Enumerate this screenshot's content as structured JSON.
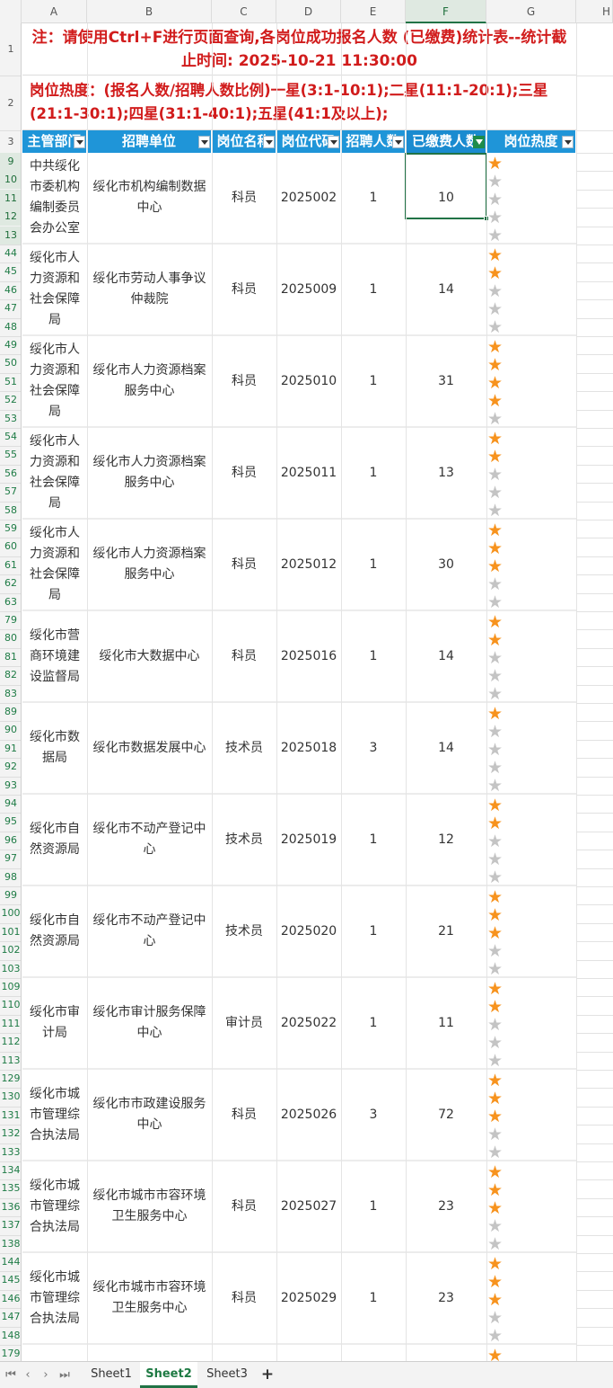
{
  "columns": [
    "A",
    "B",
    "C",
    "D",
    "E",
    "F",
    "G",
    "H"
  ],
  "title_note": "注：请使用Ctrl+F进行页面查询,各岗位成功报名人数 (已缴费)统计表--统计截止时间: 2025-10-21 11:30:00",
  "heat_note": "岗位热度：(报名人数/招聘人数比例)一星(3:1-10:1);二星(11:1-20:1);三星(21:1-30:1);四星(31:1-40:1);五星(41:1及以上);",
  "headers": [
    "主管部门",
    "招聘单位",
    "岗位名称",
    "岗位代码",
    "招聘人数",
    "已缴费人数",
    "岗位热度"
  ],
  "header_rows": [
    "1",
    "2",
    "3"
  ],
  "rows": [
    {
      "rownums": [
        "9",
        "10",
        "11",
        "12",
        "13"
      ],
      "dept": "中共绥化市委机构编制委员会办公室",
      "unit": "绥化市机构编制数据中心",
      "post": "科员",
      "code": "2025002",
      "quota": "1",
      "paid": "10",
      "stars": 1
    },
    {
      "rownums": [
        "44",
        "45",
        "46",
        "47",
        "48"
      ],
      "dept": "绥化市人力资源和社会保障局",
      "unit": "绥化市劳动人事争议仲裁院",
      "post": "科员",
      "code": "2025009",
      "quota": "1",
      "paid": "14",
      "stars": 2
    },
    {
      "rownums": [
        "49",
        "50",
        "51",
        "52",
        "53"
      ],
      "dept": "绥化市人力资源和社会保障局",
      "unit": "绥化市人力资源档案服务中心",
      "post": "科员",
      "code": "2025010",
      "quota": "1",
      "paid": "31",
      "stars": 4
    },
    {
      "rownums": [
        "54",
        "55",
        "56",
        "57",
        "58"
      ],
      "dept": "绥化市人力资源和社会保障局",
      "unit": "绥化市人力资源档案服务中心",
      "post": "科员",
      "code": "2025011",
      "quota": "1",
      "paid": "13",
      "stars": 2
    },
    {
      "rownums": [
        "59",
        "60",
        "61",
        "62",
        "63"
      ],
      "dept": "绥化市人力资源和社会保障局",
      "unit": "绥化市人力资源档案服务中心",
      "post": "科员",
      "code": "2025012",
      "quota": "1",
      "paid": "30",
      "stars": 3
    },
    {
      "rownums": [
        "79",
        "80",
        "81",
        "82",
        "83"
      ],
      "dept": "绥化市营商环境建设监督局",
      "unit": "绥化市大数据中心",
      "post": "科员",
      "code": "2025016",
      "quota": "1",
      "paid": "14",
      "stars": 2
    },
    {
      "rownums": [
        "89",
        "90",
        "91",
        "92",
        "93"
      ],
      "dept": "绥化市数据局",
      "unit": "绥化市数据发展中心",
      "post": "技术员",
      "code": "2025018",
      "quota": "3",
      "paid": "14",
      "stars": 1
    },
    {
      "rownums": [
        "94",
        "95",
        "96",
        "97",
        "98"
      ],
      "dept": "绥化市自然资源局",
      "unit": "绥化市不动产登记中心",
      "post": "技术员",
      "code": "2025019",
      "quota": "1",
      "paid": "12",
      "stars": 2
    },
    {
      "rownums": [
        "99",
        "100",
        "101",
        "102",
        "103"
      ],
      "dept": "绥化市自然资源局",
      "unit": "绥化市不动产登记中心",
      "post": "技术员",
      "code": "2025020",
      "quota": "1",
      "paid": "21",
      "stars": 3
    },
    {
      "rownums": [
        "109",
        "110",
        "111",
        "112",
        "113"
      ],
      "dept": "绥化市审计局",
      "unit": "绥化市审计服务保障中心",
      "post": "审计员",
      "code": "2025022",
      "quota": "1",
      "paid": "11",
      "stars": 2
    },
    {
      "rownums": [
        "129",
        "130",
        "131",
        "132",
        "133"
      ],
      "dept": "绥化市城市管理综合执法局",
      "unit": "绥化市市政建设服务中心",
      "post": "科员",
      "code": "2025026",
      "quota": "3",
      "paid": "72",
      "stars": 3
    },
    {
      "rownums": [
        "134",
        "135",
        "136",
        "137",
        "138"
      ],
      "dept": "绥化市城市管理综合执法局",
      "unit": "绥化市城市市容环境卫生服务中心",
      "post": "科员",
      "code": "2025027",
      "quota": "1",
      "paid": "23",
      "stars": 3
    },
    {
      "rownums": [
        "144",
        "145",
        "146",
        "147",
        "148"
      ],
      "dept": "绥化市城市管理综合执法局",
      "unit": "绥化市城市市容环境卫生服务中心",
      "post": "科员",
      "code": "2025029",
      "quota": "1",
      "paid": "23",
      "stars": 3
    }
  ],
  "last_rownum": "179",
  "sheet_tabs": [
    "Sheet1",
    "Sheet2",
    "Sheet3"
  ],
  "active_tab": "Sheet2",
  "add_sheet_label": "+",
  "nav_icons": [
    "first-sheet-icon",
    "prev-sheet-icon",
    "next-sheet-icon",
    "last-sheet-icon"
  ],
  "colors": {
    "header_blue": "#1f95d8",
    "note_red": "#d11c1c",
    "star_on": "#f7931e",
    "star_off": "#c4c4c4",
    "select_green": "#217346"
  }
}
